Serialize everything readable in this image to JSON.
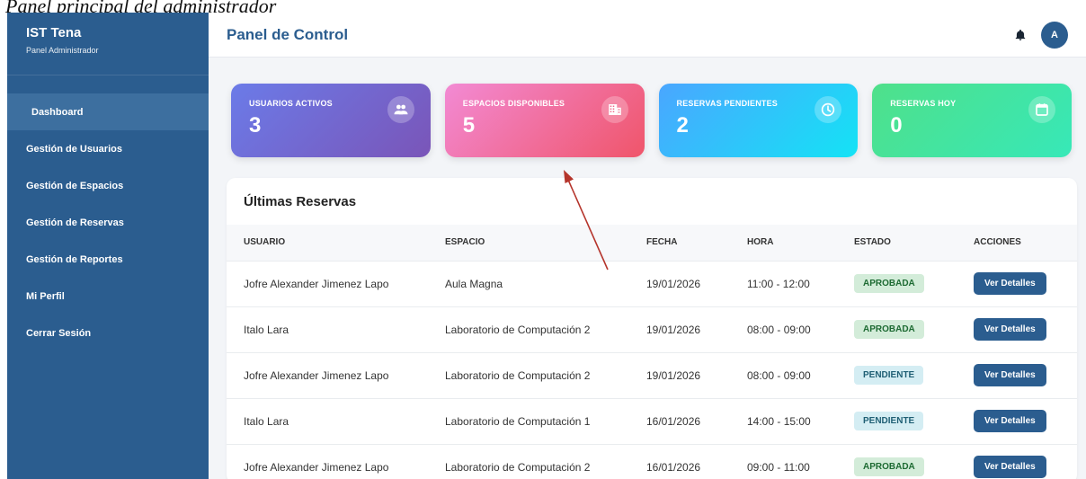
{
  "caption": "Panel principal del administrador",
  "brand": {
    "title": "IST Tena",
    "subtitle": "Panel Administrador"
  },
  "sidebar": {
    "items": [
      {
        "label": "Dashboard",
        "active": true
      },
      {
        "label": "Gestión de Usuarios"
      },
      {
        "label": "Gestión de Espacios"
      },
      {
        "label": "Gestión de Reservas"
      },
      {
        "label": "Gestión de Reportes"
      },
      {
        "label": "Mi Perfil"
      },
      {
        "label": "Cerrar Sesión"
      }
    ]
  },
  "header": {
    "title": "Panel de Control",
    "avatar_initial": "A",
    "icons": [
      "bell-icon"
    ]
  },
  "cards": [
    {
      "label": "USUARIOS ACTIVOS",
      "value": "3",
      "icon": "users-icon"
    },
    {
      "label": "ESPACIOS DISPONIBLES",
      "value": "5",
      "icon": "building-icon"
    },
    {
      "label": "RESERVAS PENDIENTES",
      "value": "2",
      "icon": "clock-icon"
    },
    {
      "label": "RESERVAS HOY",
      "value": "0",
      "icon": "calendar-icon"
    }
  ],
  "reservations": {
    "title": "Últimas Reservas",
    "columns": [
      "USUARIO",
      "ESPACIO",
      "FECHA",
      "HORA",
      "ESTADO",
      "ACCIONES"
    ],
    "rows": [
      {
        "usuario": "Jofre Alexander Jimenez Lapo",
        "espacio": "Aula Magna",
        "fecha": "19/01/2026",
        "hora": "11:00 - 12:00",
        "estado": "APROBADA",
        "accion": "Ver Detalles"
      },
      {
        "usuario": "Italo Lara",
        "espacio": "Laboratorio de Computación 2",
        "fecha": "19/01/2026",
        "hora": "08:00 - 09:00",
        "estado": "APROBADA",
        "accion": "Ver Detalles"
      },
      {
        "usuario": "Jofre Alexander Jimenez Lapo",
        "espacio": "Laboratorio de Computación 2",
        "fecha": "19/01/2026",
        "hora": "08:00 - 09:00",
        "estado": "PENDIENTE",
        "accion": "Ver Detalles"
      },
      {
        "usuario": "Italo Lara",
        "espacio": "Laboratorio de Computación 1",
        "fecha": "16/01/2026",
        "hora": "14:00 - 15:00",
        "estado": "PENDIENTE",
        "accion": "Ver Detalles"
      },
      {
        "usuario": "Jofre Alexander Jimenez Lapo",
        "espacio": "Laboratorio de Computación 2",
        "fecha": "16/01/2026",
        "hora": "09:00 - 11:00",
        "estado": "APROBADA",
        "accion": "Ver Detalles"
      }
    ]
  },
  "colors": {
    "sidebar": "#2b5d8f",
    "accent": "#2b5d8f",
    "annotation_arrow": "#b5352c"
  }
}
